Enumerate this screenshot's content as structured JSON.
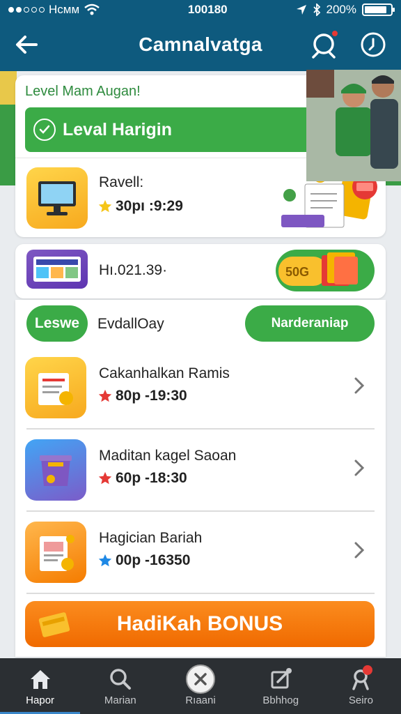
{
  "status_bar": {
    "carrier": "Hcмм",
    "time": "100180",
    "battery": "200%",
    "battery_level": 0.85,
    "icons": [
      "signal-dots-icon",
      "wifi-icon",
      "location-icon",
      "bluetooth-icon",
      "battery-icon"
    ]
  },
  "header": {
    "title": "Camnalvatga",
    "icons": [
      "back-arrow-icon",
      "search-icon",
      "info-icon"
    ]
  },
  "level_card": {
    "heading": "Level Mam Augan!",
    "banner_label": "Leval Harigin",
    "row": {
      "title": "Ravell:",
      "meta": "30pı :9:29",
      "icon": "monitor-icon",
      "star_color": "#f5c518"
    }
  },
  "promo_row": {
    "text": "Hı.021.39·",
    "icon": "gallery-icon",
    "badge": "50G"
  },
  "filter": {
    "left_pill": "Leswe",
    "label": "EvdallOay",
    "right_pill": "Narderaniap"
  },
  "tasks": [
    {
      "title": "Cakanhalkan Ramis",
      "meta": "80p -19:30",
      "icon": "document-coin-icon",
      "star_color": "#e53935"
    },
    {
      "title": "Maditan kagel Saoan",
      "meta": "60p -18:30",
      "icon": "box-icon",
      "star_color": "#e53935"
    },
    {
      "title": "Hagician Bariah",
      "meta": "00p -16350",
      "icon": "receipt-icon",
      "star_color": "#1e88e5"
    }
  ],
  "bonus_button": {
    "label": "HadiKah BONUS",
    "icon": "ticket-icon"
  },
  "bottom_nav": [
    {
      "label": "Hapor",
      "icon": "home-icon",
      "active": true
    },
    {
      "label": "Marian",
      "icon": "search-icon",
      "active": false
    },
    {
      "label": "Rıaani",
      "icon": "close-circle-icon",
      "active": false
    },
    {
      "label": "Bbhhog",
      "icon": "edit-icon",
      "active": false
    },
    {
      "label": "Seiro",
      "icon": "profile-icon",
      "active": false
    }
  ],
  "colors": {
    "header": "#0e5a7e",
    "green": "#3bab47",
    "orange": "#f57c00",
    "nav_bg": "#2b2f33"
  }
}
